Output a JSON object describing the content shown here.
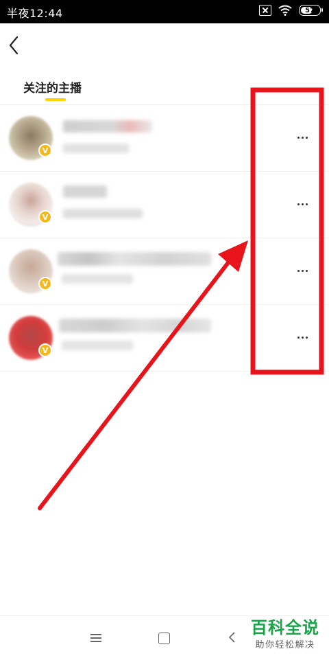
{
  "status_bar": {
    "time": "半夜12:44",
    "battery": "57"
  },
  "header": {
    "tab_label": "关注的主播",
    "accent_color": "#ffd200"
  },
  "list": {
    "items": [
      {
        "badge": "V",
        "more_label": "···"
      },
      {
        "badge": "V",
        "more_label": "···"
      },
      {
        "badge": "V",
        "more_label": "···"
      },
      {
        "badge": "V",
        "more_label": "···"
      }
    ]
  },
  "annotation": {
    "color": "#e8141b"
  },
  "navbar": {
    "icons": [
      "menu-icon",
      "home-square-icon",
      "back-triangle-icon"
    ]
  },
  "watermark": {
    "title": "百科全说",
    "subtitle": "助你轻松解决"
  }
}
